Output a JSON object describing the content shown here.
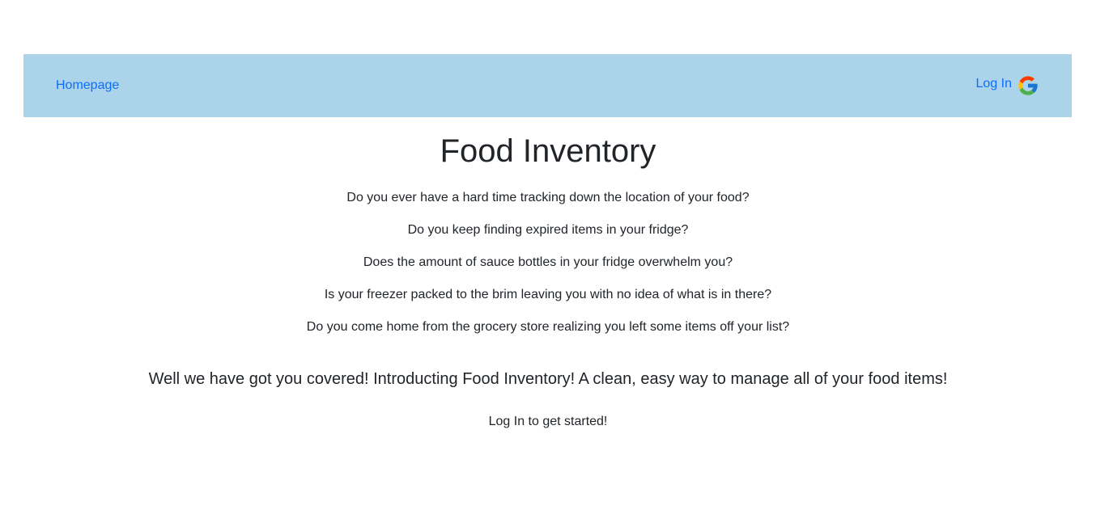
{
  "navbar": {
    "home_label": "Homepage",
    "login_label": "Log In",
    "login_icon": "google-icon",
    "background": "#abd3ea",
    "link_color": "#0d6efd"
  },
  "main": {
    "title": "Food Inventory",
    "questions": [
      "Do you ever have a hard time tracking down the location of your food?",
      "Do you keep finding expired items in your fridge?",
      "Does the amount of sauce bottles in your fridge overwhelm you?",
      "Is your freezer packed to the brim leaving you with no idea of what is in there?",
      "Do you come home from the grocery store realizing you left some items off your list?"
    ],
    "tagline": "Well we have got you covered! Introducting Food Inventory! A clean, easy way to manage all of your food items!",
    "cta": "Log In to get started!"
  }
}
